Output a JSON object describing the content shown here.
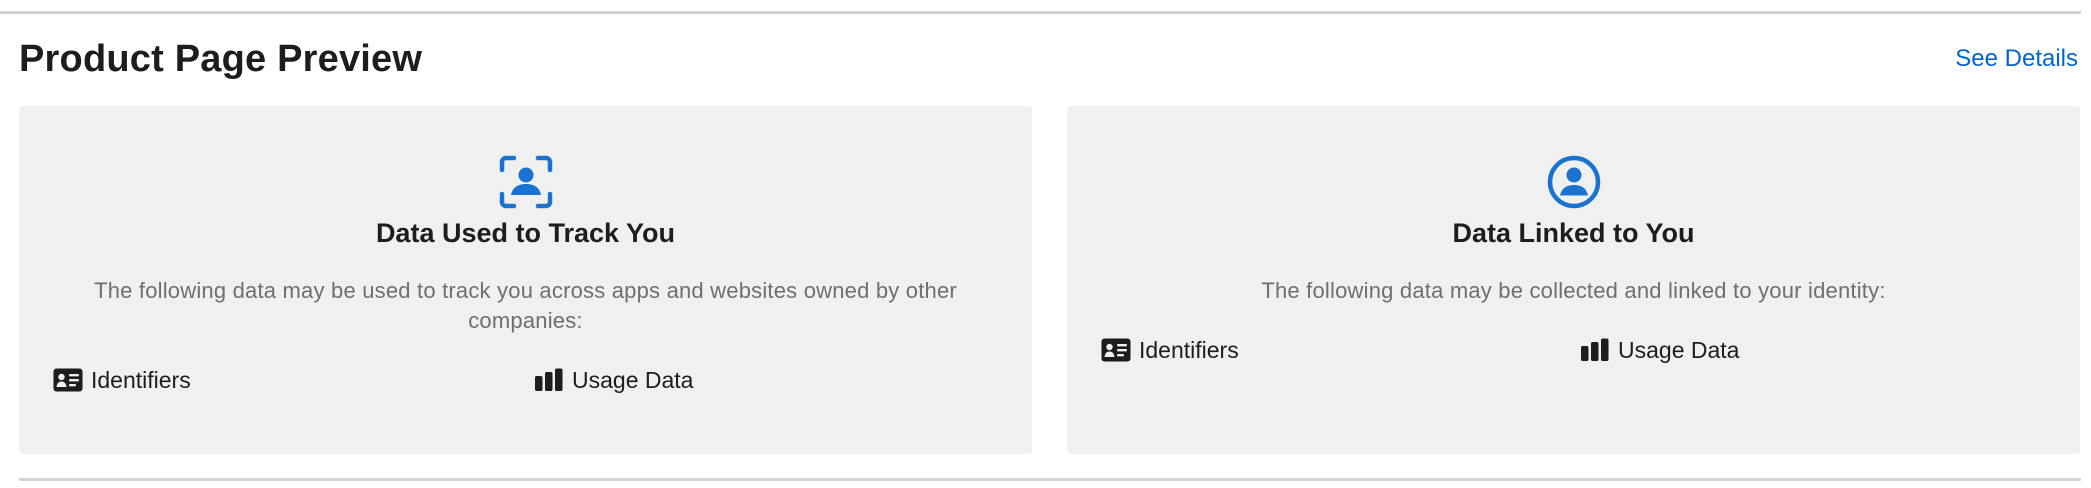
{
  "header": {
    "title": "Product Page Preview",
    "see_details_label": "See Details"
  },
  "cards": [
    {
      "icon": "person-tracking-icon",
      "title": "Data Used to Track You",
      "description": "The following data may be used to track you across apps and websites owned by other companies:",
      "items": [
        {
          "icon": "id-card-icon",
          "label": "Identifiers"
        },
        {
          "icon": "bar-chart-icon",
          "label": "Usage Data"
        }
      ]
    },
    {
      "icon": "person-circle-icon",
      "title": "Data Linked to You",
      "description": "The following data may be collected and linked to your identity:",
      "items": [
        {
          "icon": "id-card-icon",
          "label": "Identifiers"
        },
        {
          "icon": "bar-chart-icon",
          "label": "Usage Data"
        }
      ]
    }
  ],
  "colors": {
    "accent": "#0066cc",
    "icon_blue": "#1a73d0",
    "card_bg": "#f0f0f0",
    "text_primary": "#1d1d1f",
    "text_secondary": "#6e6e73"
  }
}
